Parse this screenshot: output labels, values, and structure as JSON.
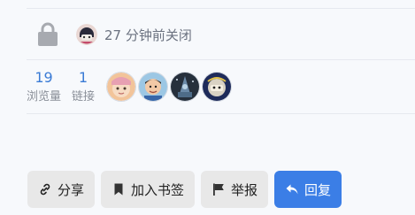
{
  "topic_status": {
    "closed_text": "27 分钟前关闭"
  },
  "stats": {
    "views": {
      "count": "19",
      "label": "浏览量"
    },
    "links": {
      "count": "1",
      "label": "链接"
    }
  },
  "participants": [
    {
      "avatar": "participant-avatar"
    },
    {
      "avatar": "participant-avatar"
    },
    {
      "avatar": "participant-avatar"
    },
    {
      "avatar": "participant-avatar"
    }
  ],
  "actions": {
    "share": {
      "label": "分享",
      "icon": "link-icon"
    },
    "bookmark": {
      "label": "加入书签",
      "icon": "bookmark-icon"
    },
    "flag": {
      "label": "举报",
      "icon": "flag-icon"
    },
    "reply": {
      "label": "回复",
      "icon": "reply-icon"
    }
  },
  "colors": {
    "accent": "#3b7ee6",
    "stat_number": "#3a7bd5",
    "muted_text": "#6b7280",
    "button_bg": "#e8e8e8"
  }
}
